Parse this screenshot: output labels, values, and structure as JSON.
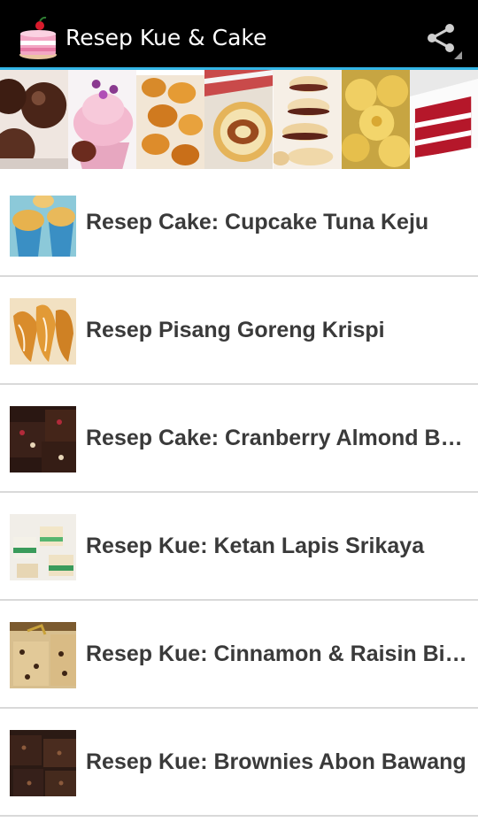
{
  "app": {
    "title": "Resep Kue & Cake",
    "icon": "cake-icon",
    "share_icon": "share-icon"
  },
  "colors": {
    "action_bar": "#000000",
    "accent": "#33b5e5",
    "item_text": "#3a3a3a",
    "divider": "#d9d9d9"
  },
  "banner": [
    {
      "name": "chocolate-truffles-photo"
    },
    {
      "name": "pink-cupcake-photo"
    },
    {
      "name": "golden-cookies-photo"
    },
    {
      "name": "swiss-roll-photo"
    },
    {
      "name": "sandwich-cookies-photo"
    },
    {
      "name": "cheese-tarts-photo"
    },
    {
      "name": "red-velvet-cake-photo"
    }
  ],
  "recipes": [
    {
      "title": "Resep Cake: Cupcake Tuna Keju",
      "thumb": "cupcake-thumb"
    },
    {
      "title": "Resep Pisang Goreng Krispi",
      "thumb": "fried-banana-thumb"
    },
    {
      "title": "Resep Cake: Cranberry Almond Br…",
      "thumb": "cranberry-brownie-thumb"
    },
    {
      "title": "Resep Kue: Ketan Lapis Srikaya",
      "thumb": "layered-sticky-rice-thumb"
    },
    {
      "title": "Resep Kue: Cinnamon & Raisin Bi…",
      "thumb": "cinnamon-raisin-thumb"
    },
    {
      "title": "Resep Kue: Brownies Abon Bawang",
      "thumb": "brownies-abon-thumb"
    }
  ]
}
